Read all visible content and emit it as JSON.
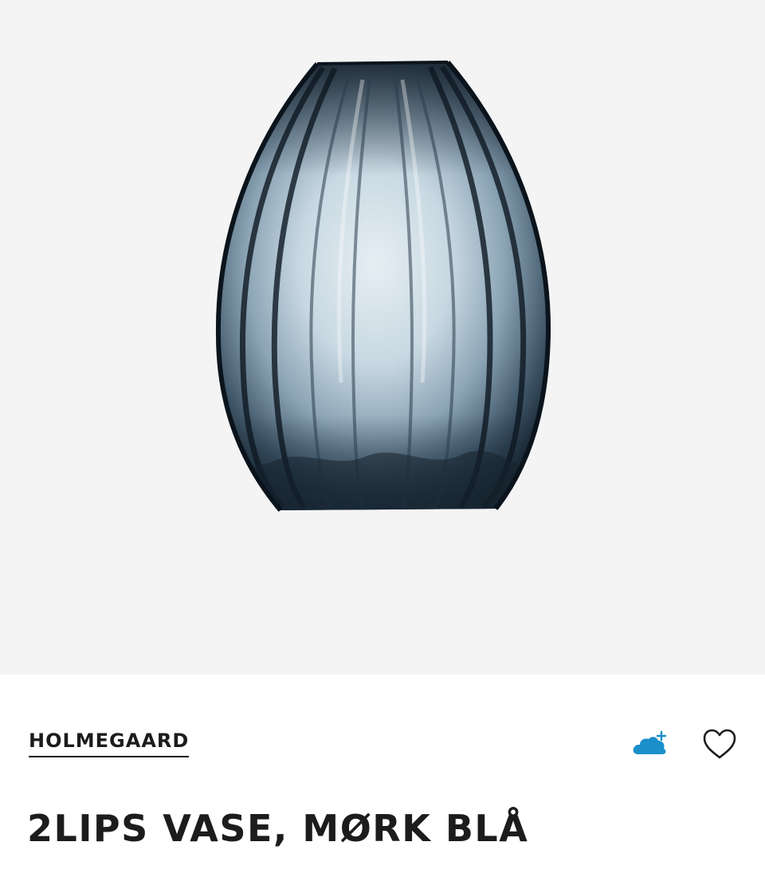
{
  "product": {
    "brand": "HOLMEGAARD",
    "title": "2LIPS VASE, MØRK BLÅ",
    "image_icon": "vase-image"
  },
  "actions": {
    "cloud_icon": "cloud-plus-icon",
    "favorite_icon": "heart-icon"
  },
  "colors": {
    "image_background": "#f4f4f4",
    "text": "#1c1c1c",
    "cloud_accent": "#1a8fc9"
  }
}
